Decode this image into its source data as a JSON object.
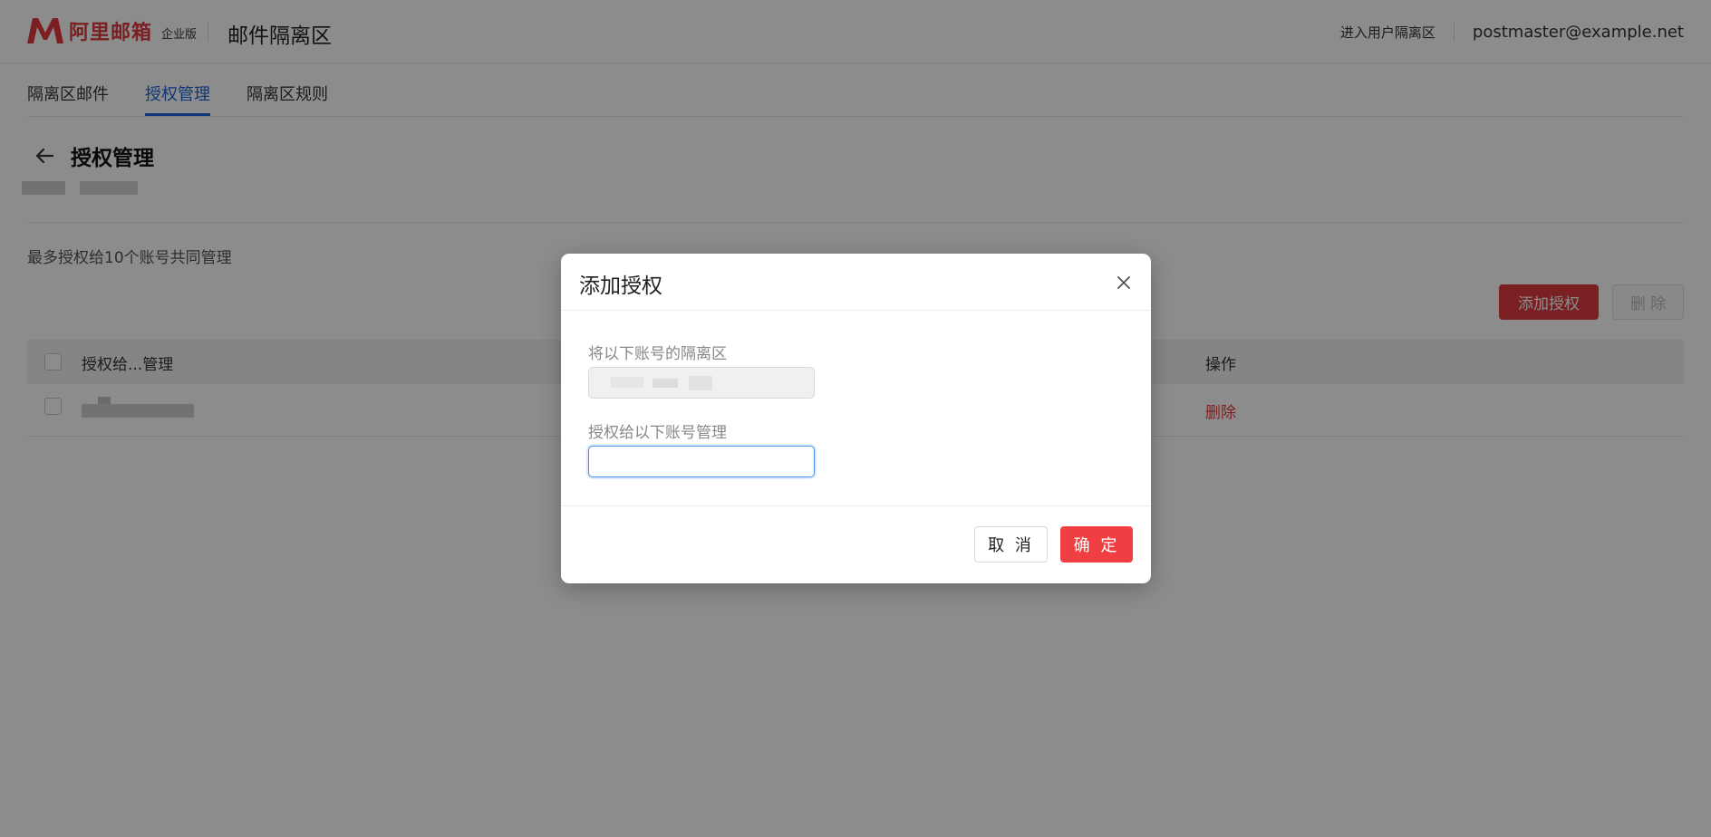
{
  "header": {
    "logo_text": "阿里邮箱",
    "logo_edition": "企业版",
    "app_title": "邮件隔离区",
    "user_zone_link": "进入用户隔离区",
    "account": "postmaster@example.net"
  },
  "tabs": [
    {
      "label": "隔离区邮件",
      "active": false
    },
    {
      "label": "授权管理",
      "active": true
    },
    {
      "label": "隔离区规则",
      "active": false
    }
  ],
  "page": {
    "title": "授权管理",
    "limit_text": "最多授权给10个账号共同管理",
    "add_button": "添加授权",
    "delete_button": "删 除"
  },
  "table": {
    "columns": [
      "授权给...管理",
      "操作"
    ],
    "rows": [
      {
        "account": "",
        "action": "删除"
      }
    ]
  },
  "modal": {
    "title": "添加授权",
    "field1_label": "将以下账号的隔离区",
    "field1_value": "",
    "field2_label": "授权给以下账号管理",
    "field2_value": "",
    "cancel": "取 消",
    "ok": "确 定"
  },
  "colors": {
    "brand_red": "#e0393e",
    "active_tab": "#1a63d8",
    "focus_blue": "#4a90e2"
  },
  "icons": {
    "logo": "logo-m-icon",
    "back": "arrow-left-icon",
    "close": "close-icon"
  }
}
